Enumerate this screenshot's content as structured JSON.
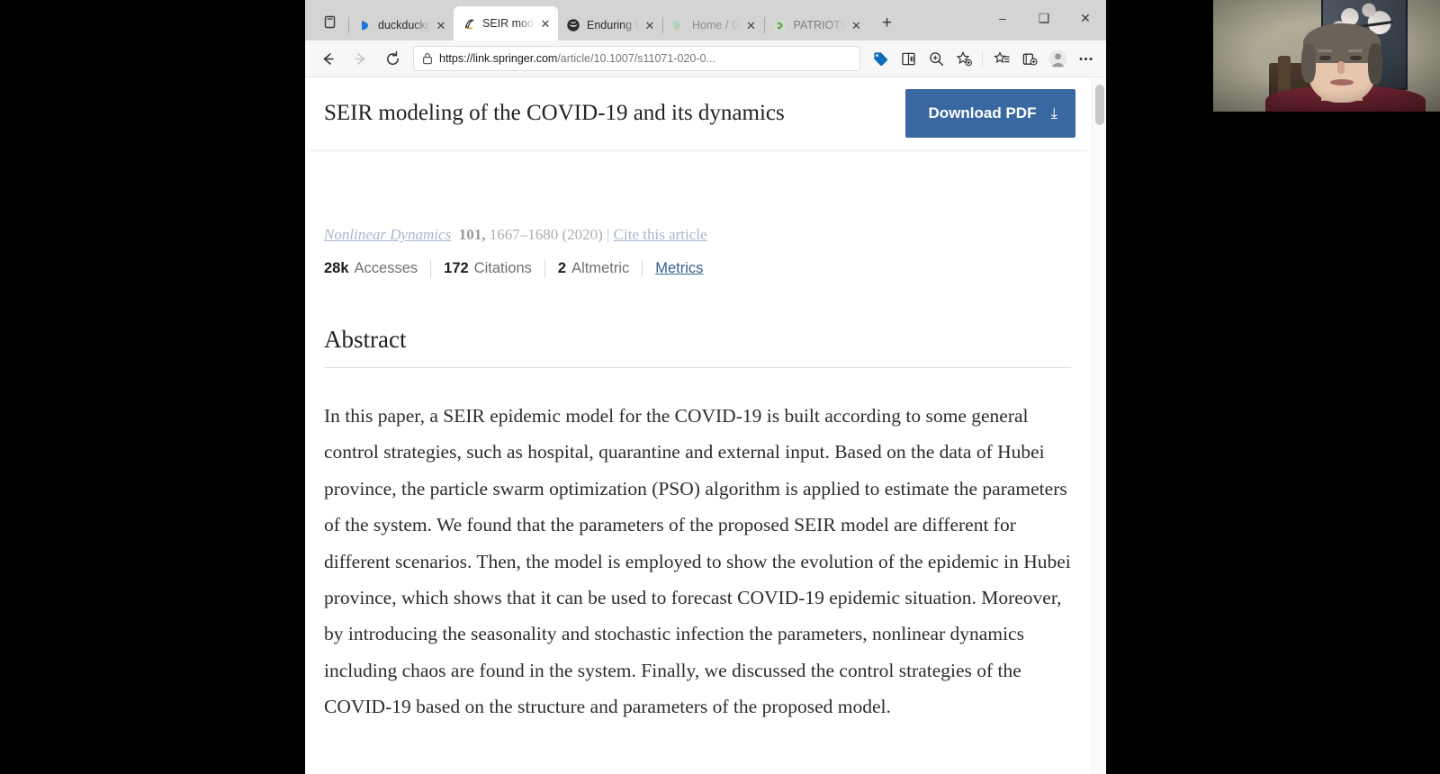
{
  "browser": {
    "tabs": [
      {
        "title": "duckduckgo",
        "favicon": "duckduckgo-icon",
        "active": false,
        "close_label": "✕"
      },
      {
        "title": "SEIR mode",
        "favicon": "springer-icon",
        "active": true,
        "close_label": "✕"
      },
      {
        "title": "Enduring W",
        "favicon": "enduring-icon",
        "active": false,
        "close_label": "✕"
      },
      {
        "title": "Home / G",
        "favicon": "github-icon",
        "active": false,
        "close_label": "✕"
      },
      {
        "title": "PATRIOTS",
        "favicon": "patriots-icon",
        "active": false,
        "close_label": "✕"
      }
    ],
    "tab_list_button": "tab-list-icon",
    "new_tab_label": "+",
    "window_controls": {
      "minimize": "‒",
      "maximize": "❑",
      "close": "✕"
    },
    "toolbar": {
      "back_label": "←",
      "forward_label": "→",
      "refresh_label": "⟳",
      "url_host": "https://link.springer.com",
      "url_path": "/article/10.1007/s11071-020-0...",
      "url_full": "https://link.springer.com/article/10.1007/s11071-020-0...",
      "lock_icon": "lock-icon",
      "icons": [
        "shopping-tag-icon",
        "read-aloud-icon",
        "zoom-icon",
        "add-favorite-icon",
        "favorites-list-icon",
        "collections-icon",
        "profile-avatar-icon",
        "settings-more-icon"
      ]
    }
  },
  "page": {
    "sticky_title": "SEIR modeling of the COVID-19 and its dynamics",
    "download_button": {
      "label": "Download PDF",
      "arrow": "⤓",
      "color": "#39679f"
    },
    "citation": {
      "journal": "Nonlinear Dynamics",
      "volume": "101",
      "pages": "1667–1680",
      "year": "(2020)",
      "divider": "|",
      "cite_link": "Cite this article"
    },
    "metrics": [
      {
        "num": "28k",
        "label": "Accesses"
      },
      {
        "num": "172",
        "label": "Citations"
      },
      {
        "num": "2",
        "label": "Altmetric"
      }
    ],
    "metrics_link": "Metrics",
    "abstract_heading": "Abstract",
    "abstract_text": "In this paper, a SEIR epidemic model for the COVID-19 is built according to some general control strategies, such as hospital, quarantine and external input. Based on the data of Hubei province, the particle swarm optimization (PSO) algorithm is applied to estimate the parameters of the system. We found that the parameters of the proposed SEIR model are different for different scenarios. Then, the model is employed to show the evolution of the epidemic in Hubei province, which shows that it can be used to forecast COVID-19 epidemic situation. Moreover, by introducing the seasonality and stochastic infection the parameters, nonlinear dynamics including chaos are found in the system. Finally, we discussed the control strategies of the COVID-19 based on the structure and parameters of the proposed model."
  },
  "webcam": {
    "label": "webcam-video-feed"
  }
}
